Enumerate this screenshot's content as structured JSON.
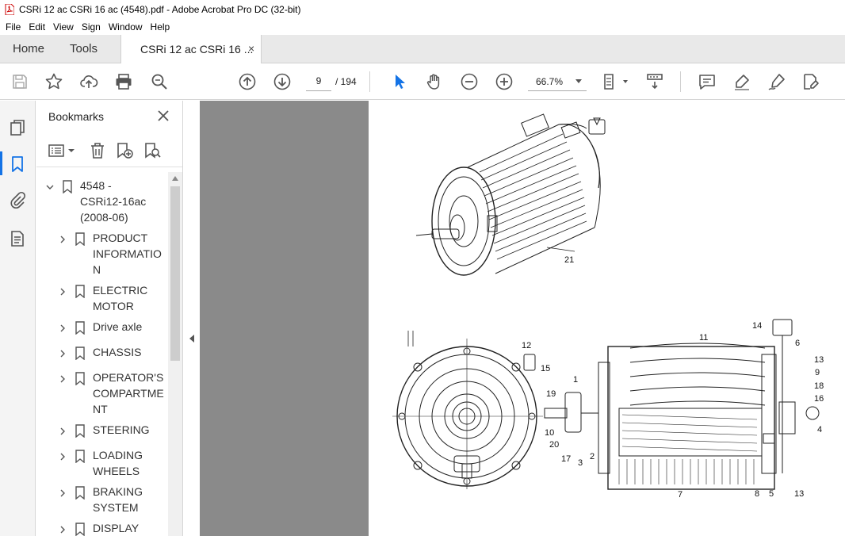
{
  "window": {
    "title": "CSRi 12 ac CSRi 16 ac (4548).pdf - Adobe Acrobat Pro DC (32-bit)"
  },
  "menu": [
    "File",
    "Edit",
    "View",
    "Sign",
    "Window",
    "Help"
  ],
  "tabs": {
    "home": "Home",
    "tools": "Tools",
    "document": "CSRi 12 ac CSRi 16 ...",
    "close": "×"
  },
  "toolbar": {
    "current_page": "9",
    "total_pages": "/ 194",
    "zoom": "66.7%"
  },
  "bookmarks": {
    "title": "Bookmarks",
    "items": [
      {
        "lines": [
          "4548 -",
          "CSRi12-16ac",
          "(2008-06)"
        ],
        "expanded": true
      },
      {
        "lines": [
          "PRODUCT",
          "INFORMATIO",
          "N"
        ]
      },
      {
        "lines": [
          "ELECTRIC",
          "MOTOR"
        ]
      },
      {
        "lines": [
          "Drive axle"
        ]
      },
      {
        "lines": [
          "CHASSIS"
        ]
      },
      {
        "lines": [
          "OPERATOR'S",
          "COMPARTME",
          "NT"
        ]
      },
      {
        "lines": [
          "STEERING"
        ]
      },
      {
        "lines": [
          "LOADING",
          "WHEELS"
        ]
      },
      {
        "lines": [
          "BRAKING",
          "SYSTEM"
        ]
      },
      {
        "lines": [
          "DISPLAY"
        ]
      }
    ]
  },
  "drawing": {
    "callouts": [
      "21",
      "12",
      "15",
      "11",
      "14",
      "6",
      "13",
      "9",
      "18",
      "16",
      "4",
      "1",
      "19",
      "10",
      "20",
      "17",
      "3",
      "2",
      "7",
      "8",
      "5",
      "13"
    ]
  },
  "colors": {
    "accent": "#1473e6",
    "doc_background": "#8a8a8a"
  }
}
